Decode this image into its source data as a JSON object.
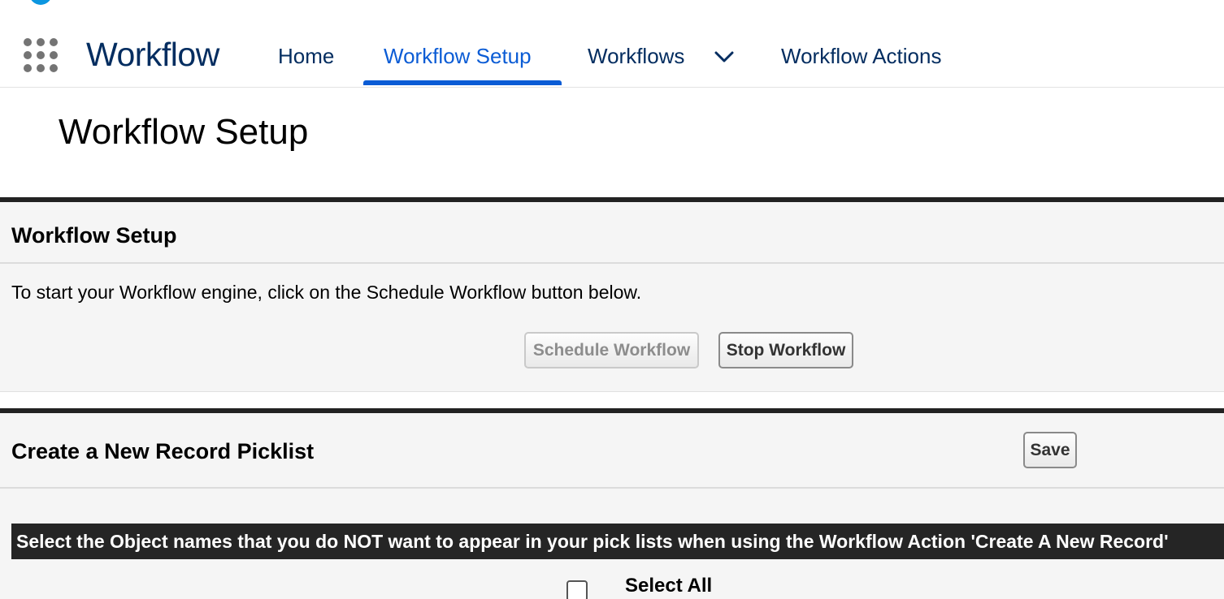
{
  "app": {
    "name": "Workflow"
  },
  "nav": {
    "items": [
      {
        "label": "Home"
      },
      {
        "label": "Workflow Setup",
        "active": true
      },
      {
        "label": "Workflows"
      },
      {
        "label": "Workflow Actions"
      }
    ],
    "accent_color": "#0b5cd5",
    "launcher_icon": "app-launcher-grid-icon",
    "dropdown_icon": "chevron-down-icon"
  },
  "page": {
    "title": "Workflow Setup"
  },
  "setup_section": {
    "title": "Workflow Setup",
    "description": "To start your Workflow engine, click on the Schedule Workflow button below.",
    "schedule_button": "Schedule Workflow",
    "stop_button": "Stop Workflow"
  },
  "picklist_section": {
    "title": "Create a New Record Picklist",
    "save_button": "Save",
    "banner": "Select the Object names that you do NOT want to appear in your pick lists when using the Workflow Action 'Create A New Record'",
    "select_all_label": "Select All",
    "select_all_checked": false
  }
}
